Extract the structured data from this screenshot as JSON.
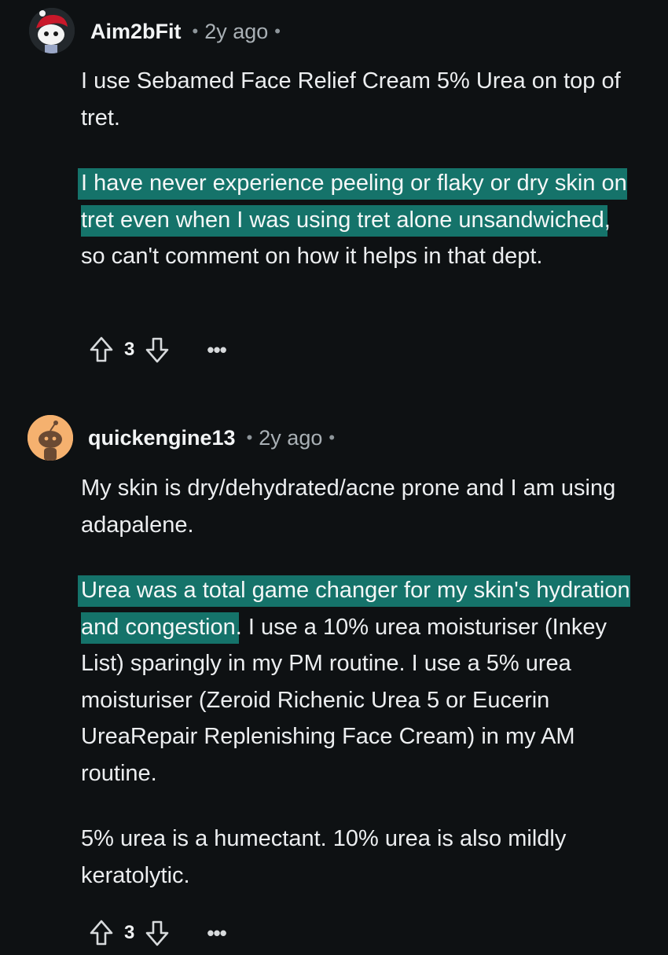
{
  "comments": [
    {
      "username": "Aim2bFit",
      "separator": "•",
      "time": "2y ago",
      "trailing_dot": "•",
      "paragraphs": [
        {
          "plain_before": "I use Sebamed Face Relief Cream 5% Urea on top of tret.",
          "highlight": "",
          "plain_after": ""
        },
        {
          "plain_before": "",
          "highlight": "I have never experience peeling or flaky or dry skin on tret even when I was using tret alone unsandwiched",
          "plain_after": ", so can't comment on how it helps in that dept."
        }
      ],
      "score": "3",
      "more": "•••"
    },
    {
      "username": "quickengine13",
      "separator": "•",
      "time": "2y ago",
      "trailing_dot": "•",
      "paragraphs": [
        {
          "plain_before": "My skin is dry/dehydrated/acne prone and I am using adapalene.",
          "highlight": "",
          "plain_after": ""
        },
        {
          "plain_before": "",
          "highlight": "Urea was a total game changer for my skin's hydration and congestion",
          "plain_after": ". I use a 10% urea moisturiser (Inkey List) sparingly in my PM routine. I use a 5% urea moisturiser (Zeroid Richenic Urea 5 or Eucerin UreaRepair Replenishing Face Cream) in my AM routine."
        },
        {
          "plain_before": "5% urea is a humectant. 10% urea is also mildly keratolytic.",
          "highlight": "",
          "plain_after": ""
        }
      ],
      "score": "3",
      "more": "•••"
    }
  ],
  "icons": {
    "upvote": "upvote-arrow-icon",
    "downvote": "downvote-arrow-icon",
    "avatar1": "snoo-avatar-red-hair",
    "avatar2": "snoo-avatar-orange"
  },
  "colors": {
    "background": "#0e1113",
    "highlight": "#15736a",
    "avatar2_bg": "#f5b16f"
  }
}
